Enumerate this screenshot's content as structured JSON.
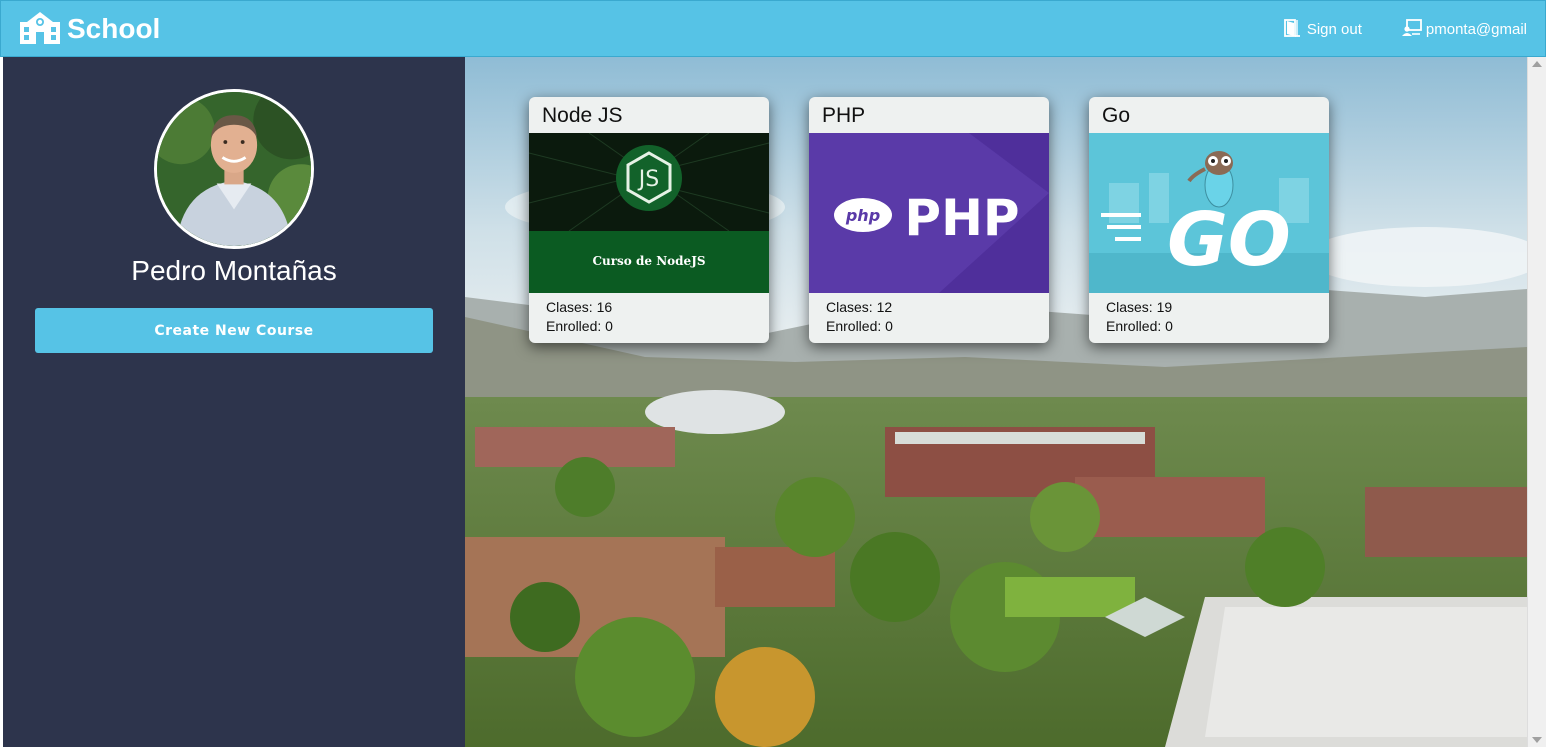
{
  "header": {
    "brand": "School",
    "sign_out_label": "Sign out",
    "user_email": "pmonta@gmail"
  },
  "sidebar": {
    "user_name": "Pedro Montañas",
    "create_button_label": "Create New Course"
  },
  "courses": [
    {
      "title": "Node JS",
      "image_caption": "Curso de NodeJS",
      "image_badge": "JS",
      "classes_label": "Clases:",
      "classes": "16",
      "enrolled_label": "Enrolled:",
      "enrolled": "0"
    },
    {
      "title": "PHP",
      "image_badge": "php",
      "image_caption": "PHP",
      "classes_label": "Clases:",
      "classes": "12",
      "enrolled_label": "Enrolled:",
      "enrolled": "0"
    },
    {
      "title": "Go",
      "image_caption": "GO",
      "classes_label": "Clases:",
      "classes": "19",
      "enrolled_label": "Enrolled:",
      "enrolled": "0"
    }
  ],
  "colors": {
    "header": "#56c3e6",
    "sidebar": "#2d344c",
    "button": "#56c3e6",
    "card": "#eef1f0"
  },
  "icons": {
    "brand": "school-icon",
    "sign_out": "door-exit-icon",
    "user": "user-monitor-icon"
  }
}
